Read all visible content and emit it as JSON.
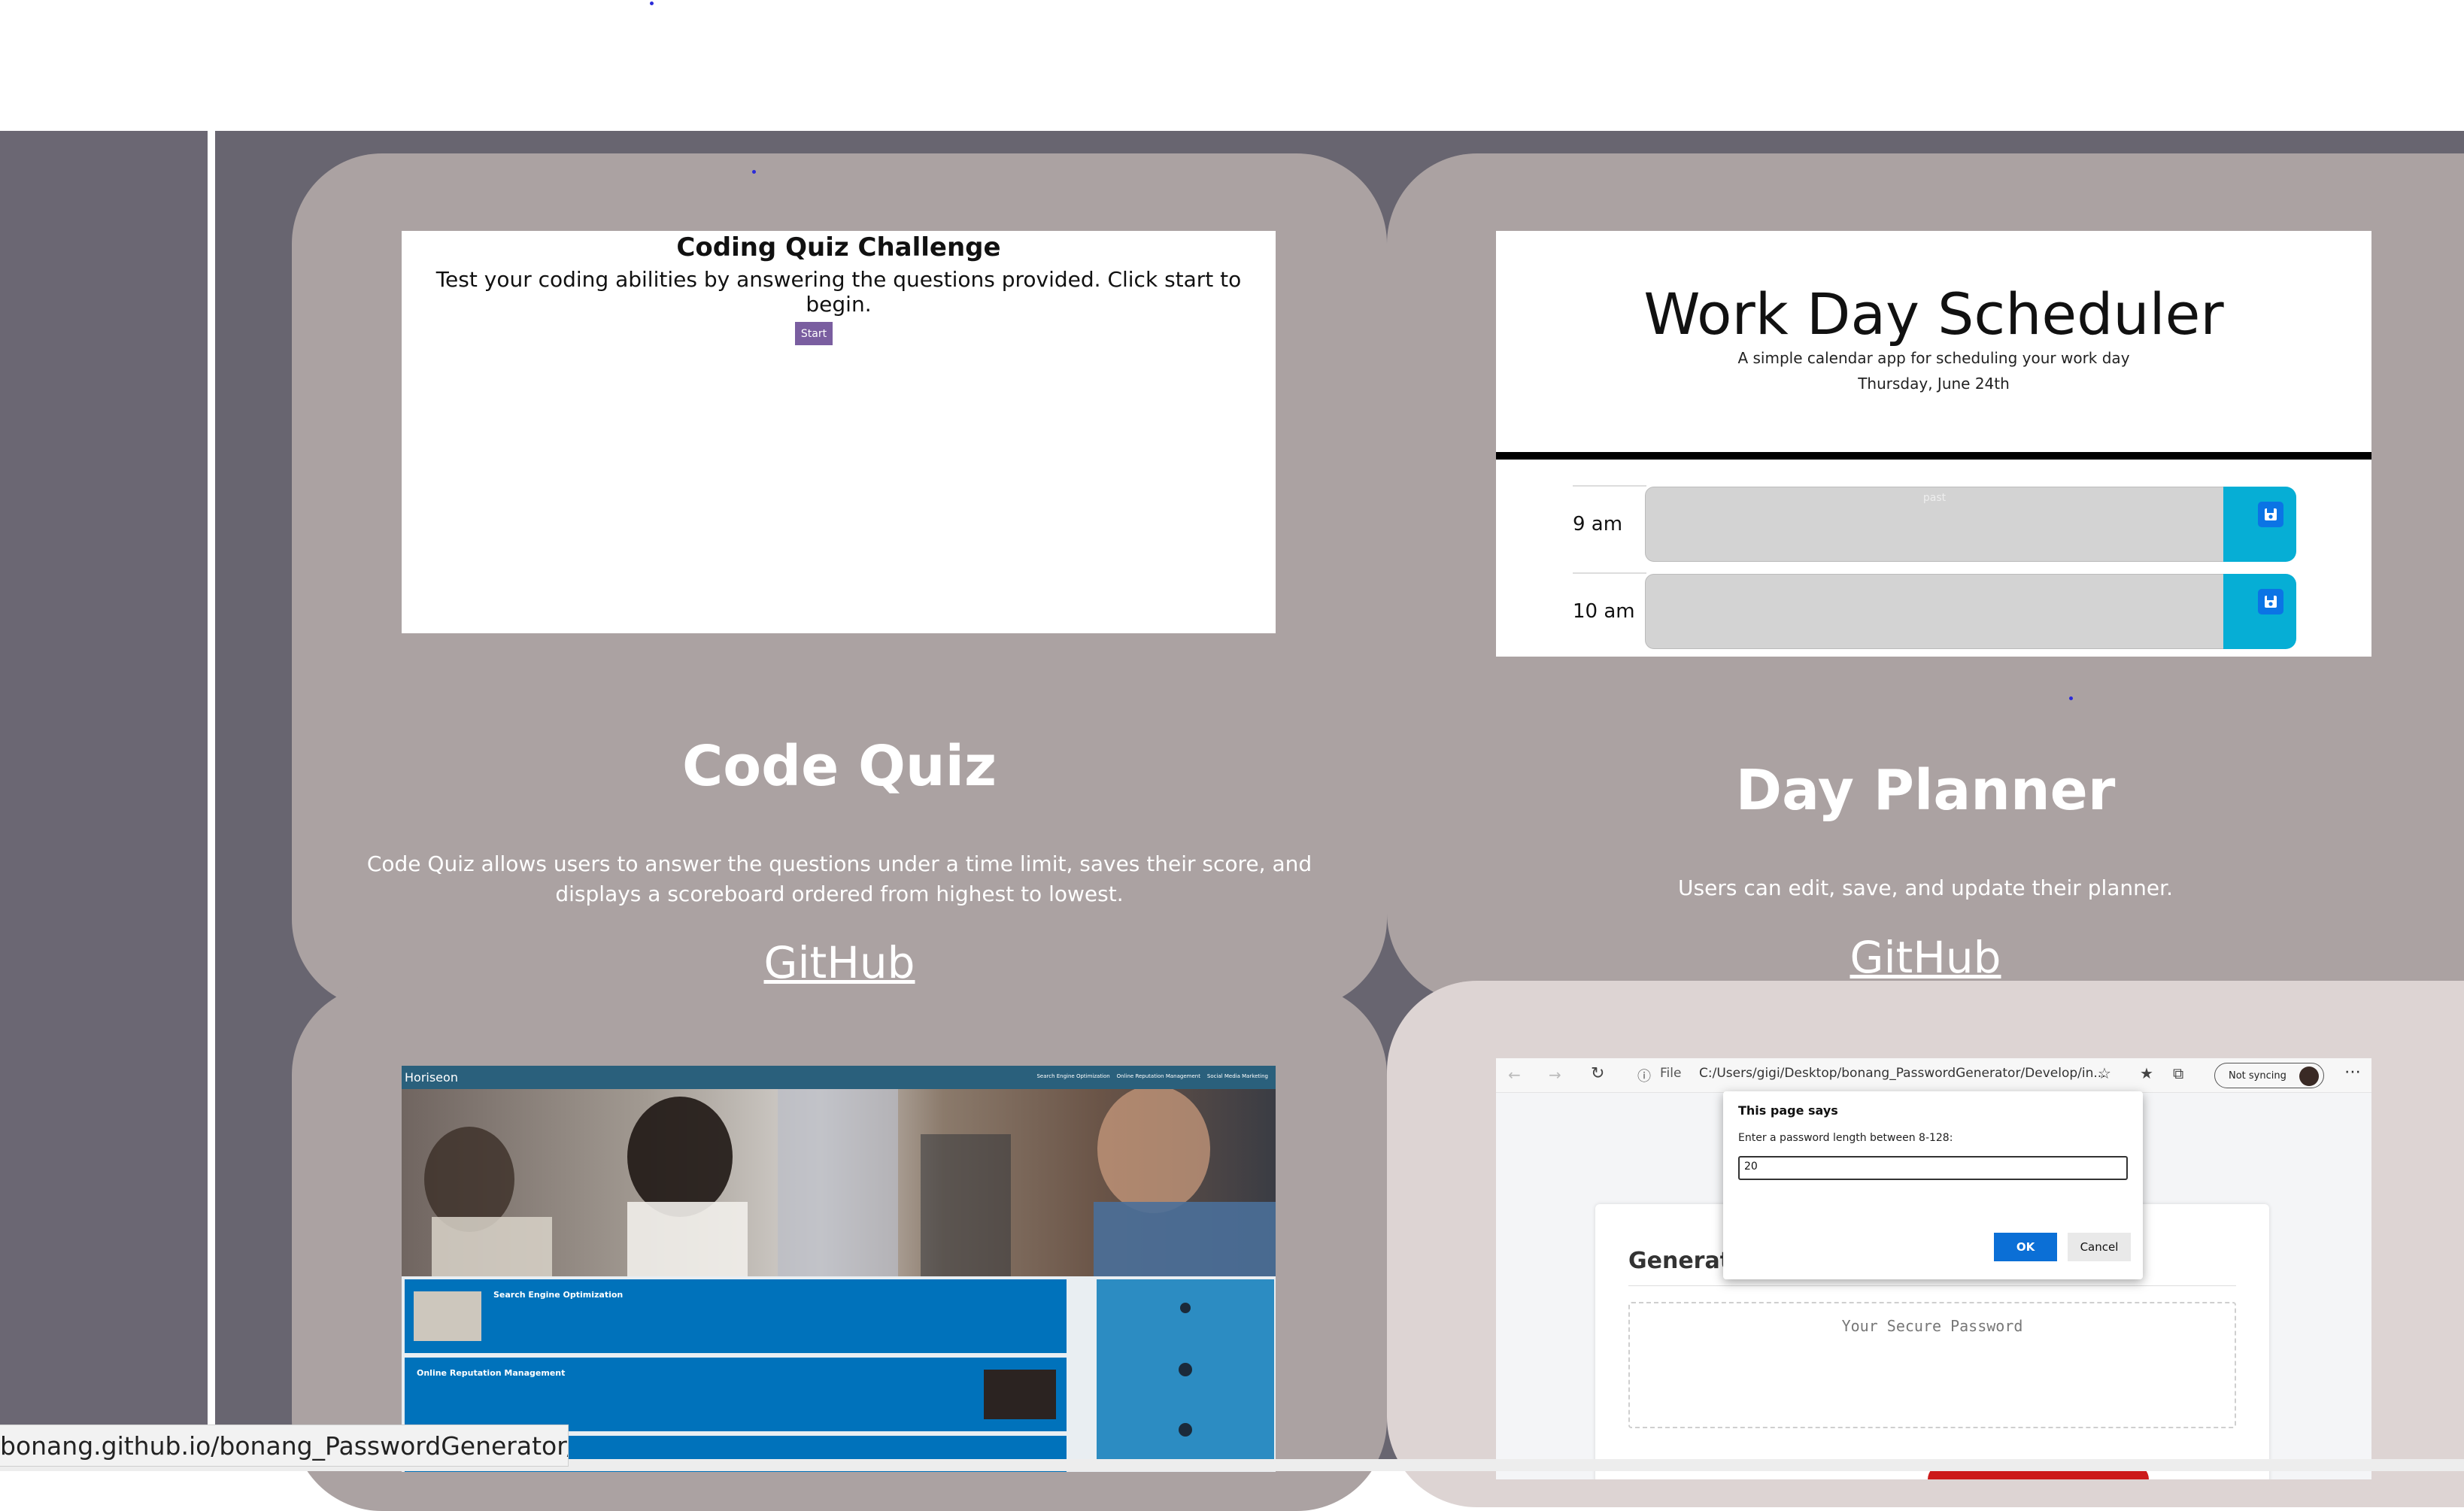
{
  "projects": [
    {
      "title": "Code Quiz",
      "description": "Code Quiz allows users to answer the questions under a time limit, saves their score, and displays a scoreboard ordered from highest to lowest.",
      "link": "GitHub",
      "screenshot": {
        "heading": "Coding Quiz Challenge",
        "subtitle": "Test your coding abilities by answering the questions provided. Click start to begin.",
        "start_button": "Start"
      }
    },
    {
      "title": "Day Planner",
      "description": "Users can edit, save, and update their planner.",
      "link": "GitHub",
      "screenshot": {
        "heading": "Work Day Scheduler",
        "subtitle": "A simple calendar app for scheduling your work day",
        "date": "Thursday, June 24th",
        "rows": [
          {
            "hour": "9 am",
            "state_label": "past"
          },
          {
            "hour": "10 am",
            "state_label": ""
          }
        ]
      }
    },
    {
      "screenshot": {
        "logo": "Horiseon",
        "nav": [
          "Search Engine Optimization",
          "Online Reputation Management",
          "Social Media Marketing"
        ],
        "sections": [
          "Search Engine Optimization",
          "Online Reputation Management"
        ]
      }
    },
    {
      "screenshot": {
        "file_label": "File",
        "url": "C:/Users/gigi/Desktop/bonang_PasswordGenerator/Develop/in...",
        "sync_label": "Not syncing",
        "dialog": {
          "title": "This page says",
          "message": "Enter a password length between 8-128:",
          "input_value": "20",
          "ok": "OK",
          "cancel": "Cancel"
        },
        "heading": "Generate a Password",
        "placeholder": "Your Secure Password"
      }
    }
  ],
  "status_url": "bonang.github.io/bonang_PasswordGenerator/",
  "colors": {
    "background": "#686570",
    "card": "#aba2a2",
    "card_light": "#ddd4d3",
    "accent_blue": "#06aed5"
  }
}
